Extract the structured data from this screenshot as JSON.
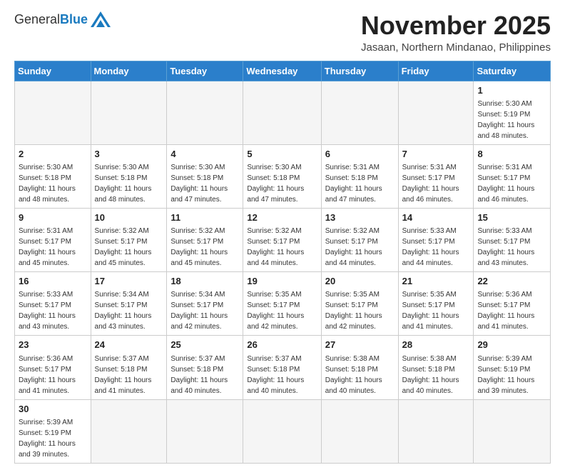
{
  "header": {
    "logo_general": "General",
    "logo_blue": "Blue",
    "month_title": "November 2025",
    "location": "Jasaan, Northern Mindanao, Philippines"
  },
  "weekdays": [
    "Sunday",
    "Monday",
    "Tuesday",
    "Wednesday",
    "Thursday",
    "Friday",
    "Saturday"
  ],
  "weeks": [
    [
      {
        "day": "",
        "info": ""
      },
      {
        "day": "",
        "info": ""
      },
      {
        "day": "",
        "info": ""
      },
      {
        "day": "",
        "info": ""
      },
      {
        "day": "",
        "info": ""
      },
      {
        "day": "",
        "info": ""
      },
      {
        "day": "1",
        "info": "Sunrise: 5:30 AM\nSunset: 5:19 PM\nDaylight: 11 hours\nand 48 minutes."
      }
    ],
    [
      {
        "day": "2",
        "info": "Sunrise: 5:30 AM\nSunset: 5:18 PM\nDaylight: 11 hours\nand 48 minutes."
      },
      {
        "day": "3",
        "info": "Sunrise: 5:30 AM\nSunset: 5:18 PM\nDaylight: 11 hours\nand 48 minutes."
      },
      {
        "day": "4",
        "info": "Sunrise: 5:30 AM\nSunset: 5:18 PM\nDaylight: 11 hours\nand 47 minutes."
      },
      {
        "day": "5",
        "info": "Sunrise: 5:30 AM\nSunset: 5:18 PM\nDaylight: 11 hours\nand 47 minutes."
      },
      {
        "day": "6",
        "info": "Sunrise: 5:31 AM\nSunset: 5:18 PM\nDaylight: 11 hours\nand 47 minutes."
      },
      {
        "day": "7",
        "info": "Sunrise: 5:31 AM\nSunset: 5:17 PM\nDaylight: 11 hours\nand 46 minutes."
      },
      {
        "day": "8",
        "info": "Sunrise: 5:31 AM\nSunset: 5:17 PM\nDaylight: 11 hours\nand 46 minutes."
      }
    ],
    [
      {
        "day": "9",
        "info": "Sunrise: 5:31 AM\nSunset: 5:17 PM\nDaylight: 11 hours\nand 45 minutes."
      },
      {
        "day": "10",
        "info": "Sunrise: 5:32 AM\nSunset: 5:17 PM\nDaylight: 11 hours\nand 45 minutes."
      },
      {
        "day": "11",
        "info": "Sunrise: 5:32 AM\nSunset: 5:17 PM\nDaylight: 11 hours\nand 45 minutes."
      },
      {
        "day": "12",
        "info": "Sunrise: 5:32 AM\nSunset: 5:17 PM\nDaylight: 11 hours\nand 44 minutes."
      },
      {
        "day": "13",
        "info": "Sunrise: 5:32 AM\nSunset: 5:17 PM\nDaylight: 11 hours\nand 44 minutes."
      },
      {
        "day": "14",
        "info": "Sunrise: 5:33 AM\nSunset: 5:17 PM\nDaylight: 11 hours\nand 44 minutes."
      },
      {
        "day": "15",
        "info": "Sunrise: 5:33 AM\nSunset: 5:17 PM\nDaylight: 11 hours\nand 43 minutes."
      }
    ],
    [
      {
        "day": "16",
        "info": "Sunrise: 5:33 AM\nSunset: 5:17 PM\nDaylight: 11 hours\nand 43 minutes."
      },
      {
        "day": "17",
        "info": "Sunrise: 5:34 AM\nSunset: 5:17 PM\nDaylight: 11 hours\nand 43 minutes."
      },
      {
        "day": "18",
        "info": "Sunrise: 5:34 AM\nSunset: 5:17 PM\nDaylight: 11 hours\nand 42 minutes."
      },
      {
        "day": "19",
        "info": "Sunrise: 5:35 AM\nSunset: 5:17 PM\nDaylight: 11 hours\nand 42 minutes."
      },
      {
        "day": "20",
        "info": "Sunrise: 5:35 AM\nSunset: 5:17 PM\nDaylight: 11 hours\nand 42 minutes."
      },
      {
        "day": "21",
        "info": "Sunrise: 5:35 AM\nSunset: 5:17 PM\nDaylight: 11 hours\nand 41 minutes."
      },
      {
        "day": "22",
        "info": "Sunrise: 5:36 AM\nSunset: 5:17 PM\nDaylight: 11 hours\nand 41 minutes."
      }
    ],
    [
      {
        "day": "23",
        "info": "Sunrise: 5:36 AM\nSunset: 5:17 PM\nDaylight: 11 hours\nand 41 minutes."
      },
      {
        "day": "24",
        "info": "Sunrise: 5:37 AM\nSunset: 5:18 PM\nDaylight: 11 hours\nand 41 minutes."
      },
      {
        "day": "25",
        "info": "Sunrise: 5:37 AM\nSunset: 5:18 PM\nDaylight: 11 hours\nand 40 minutes."
      },
      {
        "day": "26",
        "info": "Sunrise: 5:37 AM\nSunset: 5:18 PM\nDaylight: 11 hours\nand 40 minutes."
      },
      {
        "day": "27",
        "info": "Sunrise: 5:38 AM\nSunset: 5:18 PM\nDaylight: 11 hours\nand 40 minutes."
      },
      {
        "day": "28",
        "info": "Sunrise: 5:38 AM\nSunset: 5:18 PM\nDaylight: 11 hours\nand 40 minutes."
      },
      {
        "day": "29",
        "info": "Sunrise: 5:39 AM\nSunset: 5:19 PM\nDaylight: 11 hours\nand 39 minutes."
      }
    ],
    [
      {
        "day": "30",
        "info": "Sunrise: 5:39 AM\nSunset: 5:19 PM\nDaylight: 11 hours\nand 39 minutes."
      },
      {
        "day": "",
        "info": ""
      },
      {
        "day": "",
        "info": ""
      },
      {
        "day": "",
        "info": ""
      },
      {
        "day": "",
        "info": ""
      },
      {
        "day": "",
        "info": ""
      },
      {
        "day": "",
        "info": ""
      }
    ]
  ]
}
